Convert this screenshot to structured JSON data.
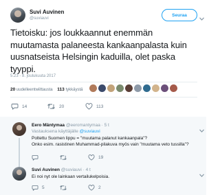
{
  "tweet": {
    "author_name": "Suvi Auvinen",
    "handle": "@suviauvi",
    "follow_label": "Seuraa",
    "dropdown_icon": "chevron-down-icon",
    "text": "Tietoisku: jos loukkaannut enemmän muutamasta palaneesta kankaanpalasta kuin uusnatseista Helsingin kaduilla, olet paska tyyppi.",
    "timestamp": "5.23 - 8. joulukuuta 2017",
    "retweets_count": "20",
    "retweets_label": "uudelleentwiittausta",
    "likes_count": "113",
    "likes_label": "tykkäystä",
    "liker_colors": [
      "#b07a5a",
      "#3b4a6b",
      "#c2a37a",
      "#7a8b6e",
      "#5a3e36",
      "#8e9aa8",
      "#2f6b8f",
      "#d2b48c",
      "#6b4f7a",
      "#a55a4a"
    ],
    "actions": {
      "replies": "14",
      "retweets": "20",
      "likes": "113"
    }
  },
  "replies": [
    {
      "author_name": "Eero Mäntymaa",
      "handle": "@eeromantymaa",
      "time": "5 t",
      "reply_to_prefix": "Vastauksena käyttäjälle",
      "reply_to_handle": "@suviauvi",
      "lines": [
        "Poltettu Suomen lippu = \"muutama palanut kankaanpala\"?",
        "Onko esim. rasistinen Muhammad-pilakuva myös vain \"muutama veto tussilla\"?"
      ],
      "counts": {
        "replies": "",
        "retweets": "",
        "likes": "19"
      }
    },
    {
      "author_name": "Suvi Auvinen",
      "handle": "@suviauvi",
      "time": "4 t",
      "lines": [
        "Ei noi nyt ole lainkaan vertailukelpoisia."
      ],
      "counts": {
        "replies": "5",
        "retweets": "",
        "likes": "2"
      }
    }
  ],
  "colors": {
    "accent": "#1da1f2",
    "muted": "#8899a6",
    "reply_bg": "#f5f8fa"
  }
}
